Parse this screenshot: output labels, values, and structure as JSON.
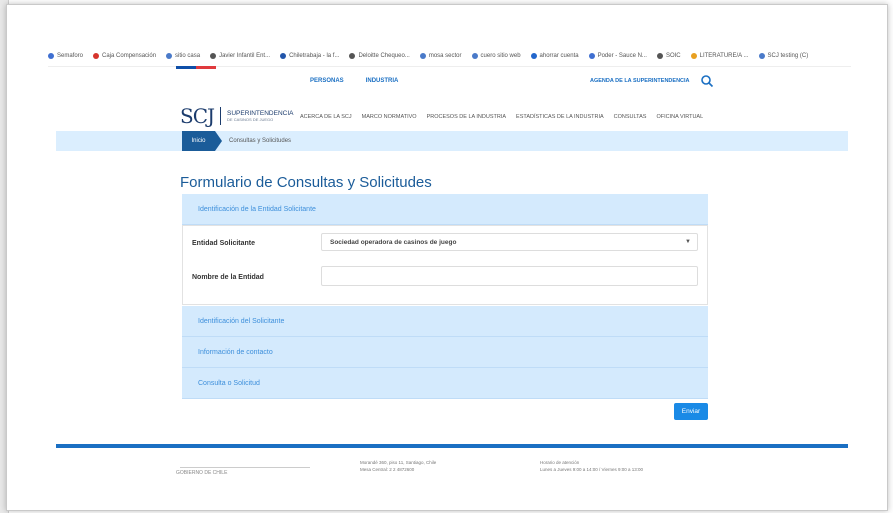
{
  "bookmarks": [
    {
      "label": "Semaforo",
      "color": "#3f6fd1"
    },
    {
      "label": "Caja Compensación",
      "color": "#d6342c"
    },
    {
      "label": "sitio casa",
      "color": "#4a7ac9"
    },
    {
      "label": "Javier Infantil Ent...",
      "color": "#555555"
    },
    {
      "label": "Chiletrabaja - la f...",
      "color": "#2255aa"
    },
    {
      "label": "Deloitte Chequeo...",
      "color": "#555555"
    },
    {
      "label": "mosa sector",
      "color": "#4a7ac9"
    },
    {
      "label": "cuero sitio web",
      "color": "#4a7ac9"
    },
    {
      "label": "ahorrar cuenta",
      "color": "#2266cc"
    },
    {
      "label": "Poder - Sauce N...",
      "color": "#3f6fd1"
    },
    {
      "label": "SOIC",
      "color": "#555555"
    },
    {
      "label": "LITERATURE/A ...",
      "color": "#e8a020"
    },
    {
      "label": "SCJ testing (C)",
      "color": "#4a7ac9"
    }
  ],
  "topnav": {
    "personas": "PERSONAS",
    "industria": "INDUSTRIA",
    "agenda": "AGENDA DE LA SUPERINTENDENCIA"
  },
  "logo": {
    "mark": "SCJ",
    "title": "SUPERINTENDENCIA",
    "subtitle": "DE CASINOS DE JUEGO"
  },
  "mainnav": [
    "ACERCA DE LA SCJ",
    "MARCO NORMATIVO",
    "PROCESOS DE LA INDUSTRIA",
    "ESTADÍSTICAS DE LA INDUSTRIA",
    "CONSULTAS",
    "OFICINA VIRTUAL"
  ],
  "breadcrumb": {
    "home": "Inicio",
    "current": "Consultas y Solicitudes"
  },
  "form": {
    "title": "Formulario de Consultas y Solicitudes",
    "section1": "Identificación de la Entidad Solicitante",
    "entity_label": "Entidad Solicitante",
    "entity_value": "Sociedad operadora de casinos de juego",
    "name_label": "Nombre de la Entidad",
    "name_value": "",
    "section2": "Identificación del Solicitante",
    "section3": "Información de contacto",
    "section4": "Consulta o Solicitud",
    "submit": "Enviar"
  },
  "footer": {
    "col1": "Morandé 360, piso 11, Santiago, Chile",
    "col1b": "Mesa Central: 2 2 4872600",
    "col2": "Horario de atención",
    "col2b": "Lunes a Jueves 9:00 a 14:00 / Viernes 9:00 a 13:00",
    "logo": "GOBIERNO DE CHILE"
  },
  "colors": {
    "primary": "#1b5c99",
    "accent": "#1a8ae6",
    "panel": "#d4eafd",
    "stripe_blue": "#0f4fa8",
    "stripe_red": "#e03a3e"
  }
}
